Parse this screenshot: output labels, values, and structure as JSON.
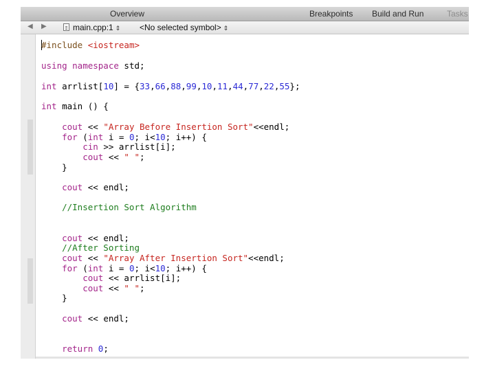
{
  "toolbar": {
    "overview": "Overview",
    "breakpoints": "Breakpoints",
    "build_and_run": "Build and Run",
    "tasks": "Tasks"
  },
  "navbar": {
    "file": "main.cpp:1",
    "symbol": "<No selected symbol>",
    "updown": "⇕"
  },
  "code": {
    "l1": [
      {
        "t": "#include ",
        "c": "pp"
      },
      {
        "t": "<iostream>",
        "c": "str"
      }
    ],
    "l2": [
      {
        "t": "using namespace ",
        "c": "kw"
      },
      {
        "t": "std;",
        "c": ""
      }
    ],
    "l3": [
      {
        "t": "int",
        "c": "kw"
      },
      {
        "t": " arrlist[",
        "c": ""
      },
      {
        "t": "10",
        "c": "num"
      },
      {
        "t": "] = {",
        "c": ""
      },
      {
        "t": "33",
        "c": "num"
      },
      {
        "t": ",",
        "c": ""
      },
      {
        "t": "66",
        "c": "num"
      },
      {
        "t": ",",
        "c": ""
      },
      {
        "t": "88",
        "c": "num"
      },
      {
        "t": ",",
        "c": ""
      },
      {
        "t": "99",
        "c": "num"
      },
      {
        "t": ",",
        "c": ""
      },
      {
        "t": "10",
        "c": "num"
      },
      {
        "t": ",",
        "c": ""
      },
      {
        "t": "11",
        "c": "num"
      },
      {
        "t": ",",
        "c": ""
      },
      {
        "t": "44",
        "c": "num"
      },
      {
        "t": ",",
        "c": ""
      },
      {
        "t": "77",
        "c": "num"
      },
      {
        "t": ",",
        "c": ""
      },
      {
        "t": "22",
        "c": "num"
      },
      {
        "t": ",",
        "c": ""
      },
      {
        "t": "55",
        "c": "num"
      },
      {
        "t": "};",
        "c": ""
      }
    ],
    "l4": [
      {
        "t": "int",
        "c": "kw"
      },
      {
        "t": " main () {",
        "c": ""
      }
    ],
    "l5": [
      {
        "t": "    cout",
        "c": "kw"
      },
      {
        "t": " << ",
        "c": ""
      },
      {
        "t": "\"Array Before Insertion Sort\"",
        "c": "str"
      },
      {
        "t": "<<endl;",
        "c": ""
      }
    ],
    "l6": [
      {
        "t": "    for",
        "c": "kw"
      },
      {
        "t": " (",
        "c": ""
      },
      {
        "t": "int",
        "c": "kw"
      },
      {
        "t": " i = ",
        "c": ""
      },
      {
        "t": "0",
        "c": "num"
      },
      {
        "t": "; i<",
        "c": ""
      },
      {
        "t": "10",
        "c": "num"
      },
      {
        "t": "; i++) {",
        "c": ""
      }
    ],
    "l7": [
      {
        "t": "        cin",
        "c": "kw"
      },
      {
        "t": " >> arrlist[i];",
        "c": ""
      }
    ],
    "l8": [
      {
        "t": "        cout",
        "c": "kw"
      },
      {
        "t": " << ",
        "c": ""
      },
      {
        "t": "\" \"",
        "c": "str"
      },
      {
        "t": ";",
        "c": ""
      }
    ],
    "l9": [
      {
        "t": "    }",
        "c": ""
      }
    ],
    "l10": [
      {
        "t": "    cout",
        "c": "kw"
      },
      {
        "t": " << endl;",
        "c": ""
      }
    ],
    "l11": [
      {
        "t": "    //Insertion Sort Algorithm",
        "c": "cmt"
      }
    ],
    "l12": [
      {
        "t": "    cout",
        "c": "kw"
      },
      {
        "t": " << endl;",
        "c": ""
      }
    ],
    "l13": [
      {
        "t": "    //After Sorting",
        "c": "cmt"
      }
    ],
    "l14": [
      {
        "t": "    cout",
        "c": "kw"
      },
      {
        "t": " << ",
        "c": ""
      },
      {
        "t": "\"Array After Insertion Sort\"",
        "c": "str"
      },
      {
        "t": "<<endl;",
        "c": ""
      }
    ],
    "l15": [
      {
        "t": "    for",
        "c": "kw"
      },
      {
        "t": " (",
        "c": ""
      },
      {
        "t": "int",
        "c": "kw"
      },
      {
        "t": " i = ",
        "c": ""
      },
      {
        "t": "0",
        "c": "num"
      },
      {
        "t": "; i<",
        "c": ""
      },
      {
        "t": "10",
        "c": "num"
      },
      {
        "t": "; i++) {",
        "c": ""
      }
    ],
    "l16": [
      {
        "t": "        cout",
        "c": "kw"
      },
      {
        "t": " << arrlist[i];",
        "c": ""
      }
    ],
    "l17": [
      {
        "t": "        cout",
        "c": "kw"
      },
      {
        "t": " << ",
        "c": ""
      },
      {
        "t": "\" \"",
        "c": "str"
      },
      {
        "t": ";",
        "c": ""
      }
    ],
    "l18": [
      {
        "t": "    }",
        "c": ""
      }
    ],
    "l19": [
      {
        "t": "    cout",
        "c": "kw"
      },
      {
        "t": " << endl;",
        "c": ""
      }
    ],
    "l20": [
      {
        "t": "    return ",
        "c": "kw"
      },
      {
        "t": "0",
        "c": "num"
      },
      {
        "t": ";",
        "c": ""
      }
    ]
  },
  "colors": {
    "keyword": "#a3258a",
    "string": "#c6251f",
    "number": "#2b2ad6",
    "comment": "#1e7d1e",
    "preprocessor": "#7a4f1c"
  },
  "icons": {
    "back": "chevron-left-icon",
    "forward": "chevron-right-icon",
    "file": "file-icon"
  }
}
